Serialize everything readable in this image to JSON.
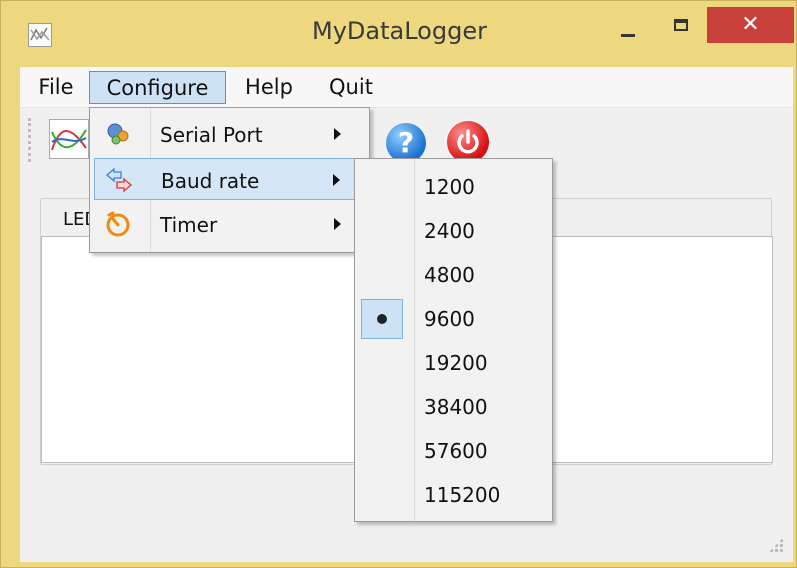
{
  "window": {
    "title": "MyDataLogger",
    "close_glyph": "✕"
  },
  "menubar": {
    "items": [
      "File",
      "Configure",
      "Help",
      "Quit"
    ]
  },
  "toolbar": {
    "help_glyph": "?"
  },
  "main": {
    "group_label": "LED"
  },
  "configure_menu": {
    "items": [
      {
        "label": "Serial Port",
        "icon": "serial-port-icon"
      },
      {
        "label": "Baud rate",
        "icon": "baud-rate-icon"
      },
      {
        "label": "Timer",
        "icon": "timer-icon"
      }
    ]
  },
  "baud_menu": {
    "options": [
      "1200",
      "2400",
      "4800",
      "9600",
      "19200",
      "38400",
      "57600",
      "115200"
    ],
    "selected": "9600"
  },
  "colors": {
    "titlebar": "#edd77f",
    "close": "#c9403b",
    "menu_highlight": "#cde3f5",
    "menu_highlight_border": "#4d97d6"
  }
}
